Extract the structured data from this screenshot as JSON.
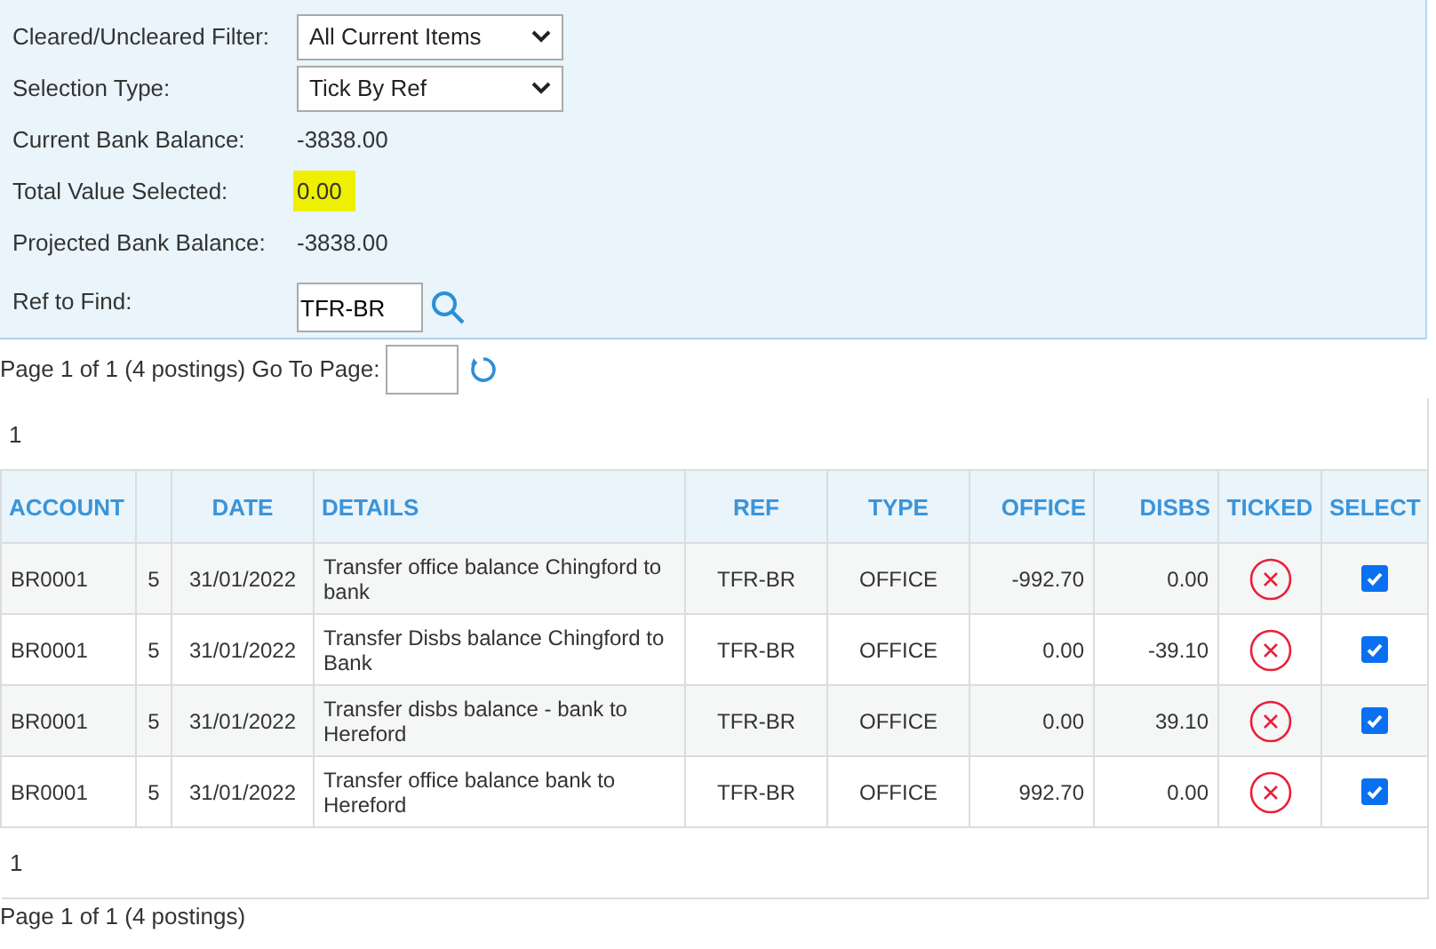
{
  "filters": [
    {
      "kind": "select",
      "label": "Cleared/Uncleared Filter:",
      "value": "All Current Items"
    },
    {
      "kind": "select",
      "label": "Selection Type:",
      "value": "Tick By Ref"
    },
    {
      "kind": "text",
      "label": "Current Bank Balance:",
      "value": "-3838.00",
      "highlighted": false
    },
    {
      "kind": "text",
      "label": "Total Value Selected:",
      "value": "0.00",
      "highlighted": true
    },
    {
      "kind": "text",
      "label": "Projected Bank Balance:",
      "value": "-3838.00",
      "highlighted": false
    },
    {
      "kind": "search",
      "label": "Ref to Find:",
      "value": "TFR-BR"
    }
  ],
  "pager_top": {
    "text": "Page 1 of 1 (4 postings) Go To Page:",
    "page_link": "1"
  },
  "table": {
    "columns": [
      {
        "label": "ACCOUNT"
      },
      {},
      {
        "label": "DATE"
      },
      {
        "label": "DETAILS"
      },
      {
        "label": "REF"
      },
      {
        "label": "TYPE"
      },
      {
        "label": "OFFICE"
      },
      {
        "label": "DISBS"
      },
      {
        "label": "TICKED"
      },
      {
        "label": "SELECT"
      }
    ],
    "rows": [
      {
        "account": "BR0001",
        "number": "5",
        "date": "31/01/2022",
        "details": "Transfer office balance Chingford to bank",
        "ref": "TFR-BR",
        "type": "OFFICE",
        "office": "-992.70",
        "disbs": "0.00",
        "ticked": false,
        "selected": true
      },
      {
        "account": "BR0001",
        "number": "5",
        "date": "31/01/2022",
        "details": "Transfer Disbs balance Chingford to Bank",
        "ref": "TFR-BR",
        "type": "OFFICE",
        "office": "0.00",
        "disbs": "-39.10",
        "ticked": false,
        "selected": true
      },
      {
        "account": "BR0001",
        "number": "5",
        "date": "31/01/2022",
        "details": "Transfer disbs balance - bank to Hereford",
        "ref": "TFR-BR",
        "type": "OFFICE",
        "office": "0.00",
        "disbs": "39.10",
        "ticked": false,
        "selected": true
      },
      {
        "account": "BR0001",
        "number": "5",
        "date": "31/01/2022",
        "details": "Transfer office balance bank to Hereford",
        "ref": "TFR-BR",
        "type": "OFFICE",
        "office": "992.70",
        "disbs": "0.00",
        "ticked": false,
        "selected": true
      }
    ]
  },
  "pager_bottom": {
    "page_link": "1",
    "text": "Page 1 of 1 (4 postings)"
  }
}
